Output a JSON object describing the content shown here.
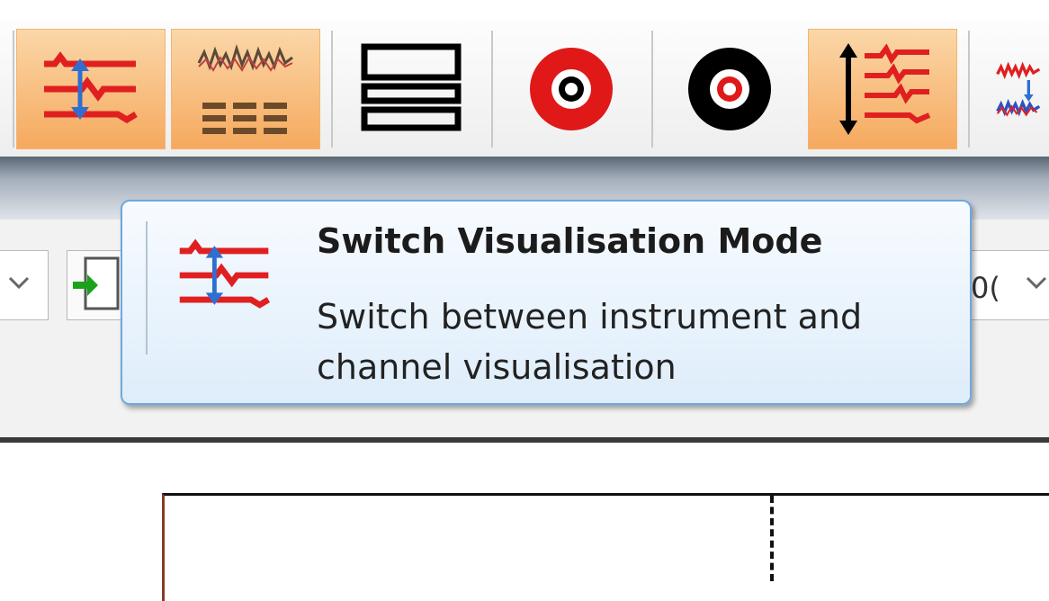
{
  "toolbar": {
    "buttons": [
      {
        "icon": "switch-visualisation-icon",
        "active": true
      },
      {
        "icon": "instrument-channels-icon",
        "active": true
      },
      {
        "icon": "layout-rows-icon",
        "active": false
      },
      {
        "icon": "red-record-target-icon",
        "active": false
      },
      {
        "icon": "black-record-target-icon",
        "active": false
      },
      {
        "icon": "scale-channels-icon",
        "active": true
      },
      {
        "icon": "overlay-channels-icon",
        "active": false
      }
    ]
  },
  "controls": {
    "right_dropdown_value": "0("
  },
  "tooltip": {
    "icon": "switch-visualisation-icon",
    "title": "Switch Visualisation Mode",
    "description": "Switch between instrument and channel visualisation"
  },
  "colors": {
    "active_button": "#f6a95e",
    "tooltip_border": "#6fa8dc",
    "signal_red": "#e02020",
    "arrow_blue": "#2f6fd1"
  }
}
